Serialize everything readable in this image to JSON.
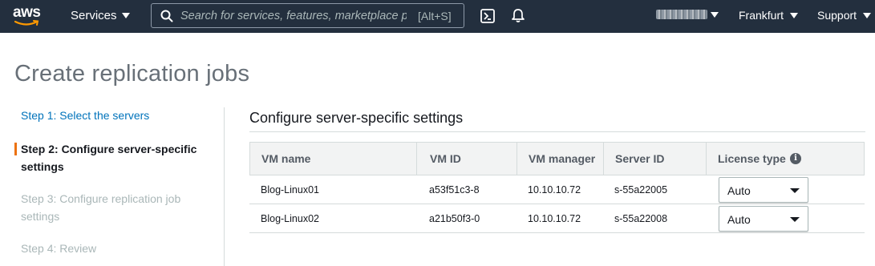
{
  "nav": {
    "logo": "aws",
    "services_label": "Services",
    "search_placeholder": "Search for services, features, marketplace pr",
    "search_shortcut": "[Alt+S]",
    "region_label": "Frankfurt",
    "support_label": "Support"
  },
  "page": {
    "title": "Create replication jobs"
  },
  "steps": {
    "step1": "Step 1: Select the servers",
    "step2": "Step 2: Configure server-specific settings",
    "step3": "Step 3: Configure replication job settings",
    "step4": "Step 4: Review"
  },
  "section": {
    "title": "Configure server-specific settings"
  },
  "table": {
    "headers": [
      "VM name",
      "VM ID",
      "VM manager",
      "Server ID",
      "License type"
    ],
    "rows": [
      {
        "vm_name": "Blog-Linux01",
        "vm_id": "a53f51c3-8",
        "vm_manager": "10.10.10.72",
        "server_id": "s-55a22005",
        "license": "Auto"
      },
      {
        "vm_name": "Blog-Linux02",
        "vm_id": "a21b50f3-0",
        "vm_manager": "10.10.10.72",
        "server_id": "s-55a22008",
        "license": "Auto"
      }
    ]
  },
  "colors": {
    "nav_bg": "#232f3e",
    "link": "#0073bb",
    "active_step_marker": "#ec7211",
    "table_header_bg": "#f2f3f3"
  },
  "icons": [
    "search-icon",
    "cloudshell-icon",
    "bell-icon",
    "info-icon",
    "chevron-down-icon"
  ]
}
